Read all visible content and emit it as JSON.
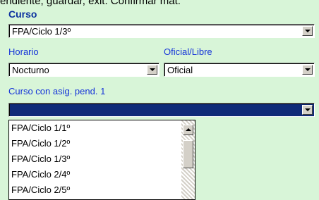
{
  "top_text": "endiente, guardar, exit. Confirmar mat.",
  "form": {
    "curso": {
      "label": "Curso",
      "value": "FPA/Ciclo 1/3º"
    },
    "horario": {
      "label": "Horario",
      "value": "Nocturno"
    },
    "oficial_libre": {
      "label": "Oficial/Libre",
      "value": "Oficial"
    },
    "curso_asig_pend": {
      "label": "Curso con asig. pend. 1",
      "value": "",
      "options": [
        "FPA/Ciclo 1/1º",
        "FPA/Ciclo 1/2º",
        "FPA/Ciclo 1/3º",
        "FPA/Ciclo 2/4º",
        "FPA/Ciclo 2/5º"
      ]
    }
  },
  "icons": {
    "dropdown_arrow": "chevron-down-icon",
    "scroll_up": "scroll-up-icon"
  },
  "colors": {
    "background": "#d8f5d8",
    "label_blue": "#1433d9",
    "selection": "#0f2a78"
  }
}
